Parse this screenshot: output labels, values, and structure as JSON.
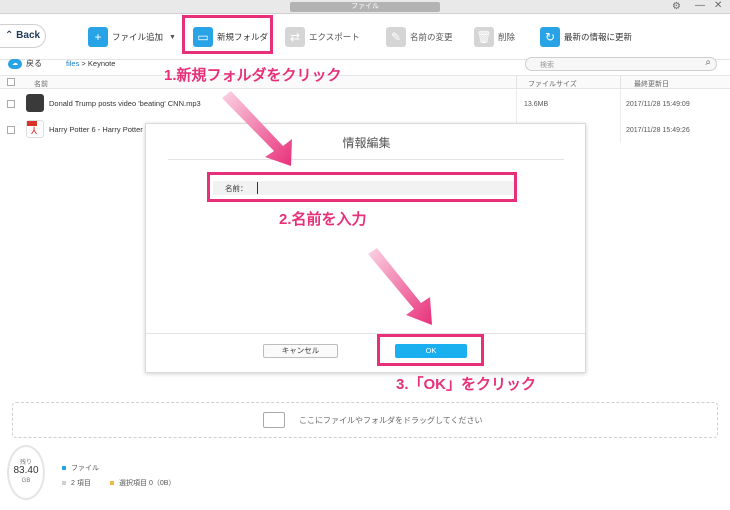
{
  "window": {
    "title": "ファイル"
  },
  "toolbar": {
    "back_label": "Back",
    "add_file": "ファイル追加",
    "new_folder": "新規フォルダ",
    "export": "エクスポート",
    "rename": "名前の変更",
    "delete": "削除",
    "refresh": "最新の情報に更新"
  },
  "pathbar": {
    "back_label": "戻る",
    "crumb_link": "files",
    "crumb_sep": " > ",
    "crumb_current": "Keynote",
    "search_placeholder": "検索"
  },
  "table": {
    "headers": {
      "name": "名前",
      "size": "ファイルサイズ",
      "date": "最終更新日"
    },
    "rows": [
      {
        "name": "Donald Trump posts video 'beating' CNN.mp3",
        "size": "13.6MB",
        "date": "2017/11/28 15:49:09",
        "icon": "music-icon"
      },
      {
        "name": "Harry Potter 6 - Harry Potter",
        "size": "",
        "date": "2017/11/28 15:49:26",
        "icon": "pdf-icon"
      }
    ]
  },
  "dialog": {
    "title": "情報編集",
    "name_label": "名前：",
    "name_value": "",
    "cancel_label": "キャンセル",
    "ok_label": "OK"
  },
  "annotations": {
    "step1": "1.新規フォルダをクリック",
    "step2": "2.名前を入力",
    "step3": "3.「OK」をクリック"
  },
  "dropzone": {
    "text": "ここにファイルやフォルダをドラッグしてください"
  },
  "storage": {
    "remaining_label": "残り",
    "remaining_value": "83.40",
    "unit": "GB",
    "category": "ファイル",
    "items": "2 項目",
    "selected": "選択項目 0（0B）"
  },
  "colors": {
    "accent": "#27a3e6",
    "highlight": "#e8307a",
    "ok_button": "#1ab0ef"
  }
}
